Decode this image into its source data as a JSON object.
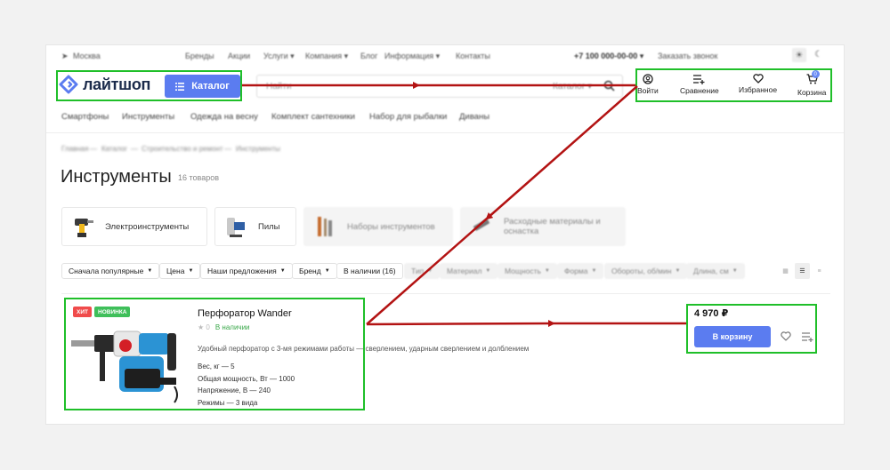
{
  "topbar": {
    "city": "Москва",
    "links": [
      "Бренды",
      "Акции",
      "Услуги ▾",
      "Компания ▾",
      "Блог",
      "Информация ▾",
      "Контакты"
    ],
    "phone": "+7 100 000-00-00 ▾",
    "callback": "Заказать звонок"
  },
  "header": {
    "logo": "лайтшоп",
    "catalog_label": "Каталог",
    "search_placeholder": "Найти",
    "search_scope": "Каталог ▾",
    "actions": {
      "login": "Войти",
      "compare": "Сравнение",
      "favorites": "Избранное",
      "cart": "Корзина",
      "cart_count": "0"
    }
  },
  "nav_categories": [
    "Смартфоны",
    "Инструменты",
    "Одежда на весну",
    "Комплект сантехники",
    "Набор для рыбалки",
    "Диваны"
  ],
  "breadcrumbs": [
    "Главная",
    "—",
    "Каталог",
    "—",
    "Строительство и ремонт",
    "—",
    "Инструменты"
  ],
  "page_title": "Инструменты",
  "product_count": "16 товаров",
  "subcategories": [
    "Электроинструменты",
    "Пилы",
    "Наборы инструментов",
    "Расходные материалы и оснастка"
  ],
  "filters": {
    "active": [
      "Сначала популярные",
      "Цена",
      "Наши предложения",
      "Бренд",
      "В наличии (16)"
    ],
    "faded": [
      "Тип",
      "Материал",
      "Мощность",
      "Форма",
      "Обороты, об/мин",
      "Длина, см"
    ]
  },
  "product": {
    "tag_hit": "ХИТ",
    "tag_new": "НОВИНКА",
    "name": "Перфоратор Wander",
    "rating": "0",
    "stock": "В наличии",
    "description": "Удобный перфоратор с 3-мя режимами работы — сверлением, ударным сверлением и долблением",
    "specs": [
      "Вес, кг — 5",
      "Общая мощность, Вт — 1000",
      "Напряжение, В — 240",
      "Режимы — 3 вида"
    ],
    "price": "4 970 ₽",
    "cart_button": "В корзину"
  },
  "colors": {
    "accent": "#5b7cf0",
    "highlight_box": "#1fbf29",
    "arrow": "#b31313",
    "tag_hit": "#f04b4b",
    "tag_new": "#3fbf5a",
    "stock": "#3aa84a"
  }
}
